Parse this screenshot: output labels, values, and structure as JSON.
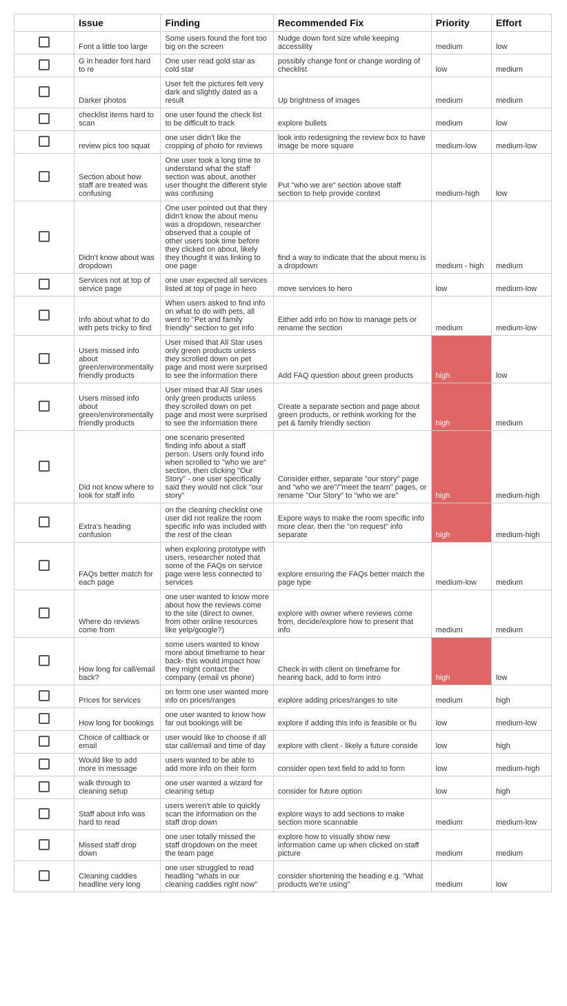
{
  "headers": {
    "check": "",
    "issue": "Issue",
    "finding": "Finding",
    "fix": "Recommended Fix",
    "priority": "Priority",
    "effort": "Effort"
  },
  "rows": [
    {
      "issue": "Font a little too large",
      "finding": "Some users found the font too big on the screen",
      "fix": "Nudge down font size while keeping accessility",
      "priority": "medium",
      "effort": "low",
      "priority_hl": false
    },
    {
      "issue": "G in header font hard to re",
      "finding": "One user read gold star as cold star",
      "fix": "possibly change font or change wording of checklist",
      "priority": "low",
      "effort": "medium",
      "priority_hl": false
    },
    {
      "issue": "Darker photos",
      "finding": "User felt the pictures felt very dark and slightly dated as a result",
      "fix": "Up brightness of images",
      "priority": "medium",
      "effort": "medium",
      "priority_hl": false
    },
    {
      "issue": "checklist items hard to scan",
      "finding": "one user found the check list to be difficult to track",
      "fix": "explore bullets",
      "priority": "medium",
      "effort": "low",
      "priority_hl": false
    },
    {
      "issue": "review pics too squat",
      "finding": "one user didn't like the cropping of photo for reviews",
      "fix": "look into redesigning the review box to have image be more square",
      "priority": "medium-low",
      "effort": "medium-low",
      "priority_hl": false
    },
    {
      "issue": "Section about how staff are treated was confusing",
      "finding": "One user took a long time to understand what the staff section was about, another user thought the different style was confusing",
      "fix": "Put \"who we are\" section above staff section to help provide context",
      "priority": "medium-high",
      "effort": "low",
      "priority_hl": false
    },
    {
      "issue": "Didn't know about was dropdown",
      "finding": "One user pointed out that they didn't know the about menu was a dropdown, researcher observed that a couple of other users took time before they clicked on about, likely they thought it was linking to one page",
      "fix": "find a way to indicate that the about menu is a dropdown",
      "priority": "medium - high",
      "effort": "medium",
      "priority_hl": false
    },
    {
      "issue": "Services not at top of service page",
      "finding": "one user expected all services listed at top of page in hero",
      "fix": "move services to hero",
      "priority": "low",
      "effort": "medium-low",
      "priority_hl": false
    },
    {
      "issue": "Info about what to do with pets tricky to find",
      "finding": "When users asked to find info on what to do with pets, all went to \"Pet and family friendly\" section to get info",
      "fix": "Either add info on how to manage pets or rename the section",
      "priority": "medium",
      "effort": "medium-low",
      "priority_hl": false
    },
    {
      "issue": "Users missed info about green/environmentally friendly products",
      "finding": "User mised that All Star uses only green products unless they scrolled down on pet page and most were surprised to see the information there",
      "fix": "Add FAQ question about green products",
      "priority": "high",
      "effort": "low",
      "priority_hl": true
    },
    {
      "issue": "Users missed info about green/environmentally friendly products",
      "finding": "User mised that All Star uses only green products unless they scrolled down on pet page and most were surprised to see the information there",
      "fix": "Create a separate section and page about green products, or rethink working for the pet & family friendly section",
      "priority": "high",
      "effort": "medium",
      "priority_hl": true
    },
    {
      "issue": "Did not know where to look for staff info",
      "finding": "one scenario presented finding info about a staff person. Users only found info when scrolled to \"who we are\" section, then clicking \"Our Story\" - one user specifically said they would not click \"our story\"",
      "fix": "Consider either, separate \"our story\" page and \"who we are\"/\"meet the team\" pages, or rename \"Our Story\" to \"who we are\"",
      "priority": "high",
      "effort": "medium-high",
      "priority_hl": true
    },
    {
      "issue": "Extra's heading confusion",
      "finding": "on the cleaning checklist one user did not realize the room specific info was included with the rest of the clean",
      "fix": "Expore ways to make the room specific info more clear, then the \"on request\" info separate",
      "priority": "high",
      "effort": "medium-high",
      "priority_hl": true
    },
    {
      "issue": "FAQs better match for each page",
      "finding": "when exploring prototype with users, researcher noted that some of the FAQs on service page were less connected to services",
      "fix": "explore ensuring the FAQs better match the page type",
      "priority": "medium-low",
      "effort": "medium",
      "priority_hl": false
    },
    {
      "issue": "Where do reviews come from",
      "finding": "one user wanted to know more about how the reviews come to the site (direct to owner, from other online resources like yelp/google?)",
      "fix": "explore with owner where reviews come from, decide/explore how to present that info",
      "priority": "medium",
      "effort": "medium",
      "priority_hl": false
    },
    {
      "issue": "How long for call/email back?",
      "finding": "some users wanted to know more about timeframe to hear back- this would impact how they might contact the company (email vs phone)",
      "fix": "Check in with client on timeframe for hearing back, add to form intro",
      "priority": "high",
      "effort": "low",
      "priority_hl": true
    },
    {
      "issue": "Prices for services",
      "finding": "on form one user wanted more info on prices/ranges",
      "fix": "explore adding prices/ranges to site",
      "priority": "medium",
      "effort": "high",
      "priority_hl": false
    },
    {
      "issue": "How long for bookings",
      "finding": "one user wanted to know how far out bookings will be",
      "fix": "explore if adding this info is feasible or flu",
      "priority": "low",
      "effort": "medium-low",
      "priority_hl": false
    },
    {
      "issue": "Choice of callback or email",
      "finding": "user would like to choose if all star call/email and time of day",
      "fix": "explore with client - likely a future conside",
      "priority": "low",
      "effort": "high",
      "priority_hl": false
    },
    {
      "issue": "Would like to add more in message",
      "finding": "users wanted to be able to add more info on their form",
      "fix": "consider open text field to add to form",
      "priority": "low",
      "effort": "medium-high",
      "priority_hl": false
    },
    {
      "issue": "walk through to cleaning setup",
      "finding": "one user wanted a wizard for cleaning setup",
      "fix": "consider for future option",
      "priority": "low",
      "effort": "high",
      "priority_hl": false
    },
    {
      "issue": "Staff about info was hard to read",
      "finding": "users weren't able to quickly scan the information on the staff drop down",
      "fix": "explore ways to add sections to make section more scannable",
      "priority": "medium",
      "effort": "medium-low",
      "priority_hl": false
    },
    {
      "issue": "Missed staff drop down",
      "finding": "one user totally missed the staff dropdown on the meet the team page",
      "fix": "explore how to visually show new information came up when clicked on staff picture",
      "priority": "medium",
      "effort": "medium",
      "priority_hl": false
    },
    {
      "issue": "Cleaning caddies headline very long",
      "finding": "one user struggled to read headling \"whats in our cleaning caddies right now\"",
      "fix": "consider shortening the heading e.g. \"What products we're using\"",
      "priority": "medium",
      "effort": "low",
      "priority_hl": false
    }
  ]
}
